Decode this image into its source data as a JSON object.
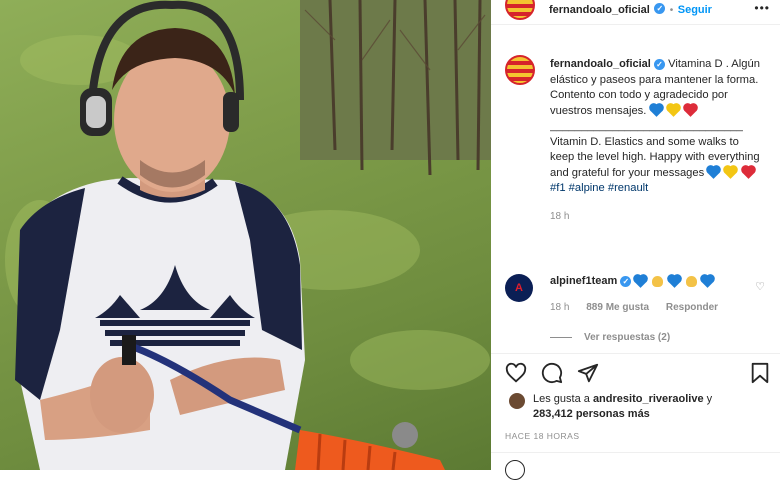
{
  "post": {
    "author": "fernandoalo_oficial",
    "follow_label": "Seguir",
    "separator": "•",
    "more_label": "•••",
    "caption_es": "Vitamina D . Algún elástico y paseos para mantener la forma. Contento con todo y agradecido por vuestros mensajes.",
    "caption_rule": "_______________________________",
    "caption_en": "Vitamin D. Elastics and some walks to keep the level high. Happy with everything and grateful for your messages",
    "hashtags": "#f1 #alpine #renault",
    "caption_time": "18 h"
  },
  "comment": {
    "author": "alpinef1team",
    "avatar_label": "A",
    "time": "18 h",
    "likes": "889 Me gusta",
    "reply_label": "Responder",
    "view_replies": "Ver respuestas (2)"
  },
  "likes": {
    "prefix": "Les gusta a",
    "user": "andresito_riveraolive",
    "conj": "y",
    "count": "283,412 personas más"
  },
  "posted_ago": "HACE 18 HORAS",
  "icons": [
    "heart-icon",
    "comment-icon",
    "share-icon",
    "bookmark-icon",
    "verified-icon"
  ],
  "colors": {
    "accent": "#0095f6",
    "verified": "#3897f0",
    "muted": "#8e8e8e"
  }
}
